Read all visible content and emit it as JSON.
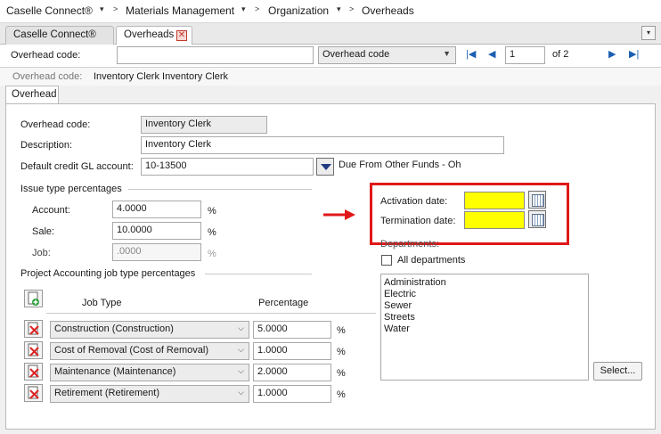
{
  "breadcrumb": {
    "items": [
      "Caselle Connect®",
      "Materials Management",
      "Organization",
      "Overheads"
    ]
  },
  "tabs": [
    {
      "label": "Caselle Connect®"
    },
    {
      "label": "Overheads"
    }
  ],
  "toolbar": {
    "code_label": "Overhead code:",
    "code_value": "",
    "sort_select": "Overhead code",
    "record_number": "1",
    "record_total": "of 2"
  },
  "subheader": {
    "label": "Overhead code:",
    "value": "Inventory Clerk  Inventory Clerk"
  },
  "inner_tab": "Overhead",
  "form": {
    "overhead_code_label": "Overhead code:",
    "overhead_code_value": "Inventory Clerk",
    "description_label": "Description:",
    "description_value": "Inventory Clerk",
    "gl_label": "Default credit GL account:",
    "gl_value": "10-13500",
    "gl_description": "Due From Other Funds - Oh"
  },
  "issue_type": {
    "title": "Issue type percentages",
    "account_label": "Account:",
    "account_value": "4.0000",
    "sale_label": "Sale:",
    "sale_value": "10.0000",
    "job_label": "Job:",
    "job_value": ".0000",
    "percent_sign": "%"
  },
  "dates": {
    "activation_label": "Activation date:",
    "activation_value": "",
    "termination_label": "Termination date:",
    "termination_value": ""
  },
  "departments": {
    "title": "Departments:",
    "all_label": "All departments",
    "items": [
      "Administration",
      "Electric",
      "Sewer",
      "Streets",
      "Water"
    ],
    "select_button": "Select..."
  },
  "pa": {
    "title": "Project Accounting job type percentages",
    "col_job": "Job Type",
    "col_pct": "Percentage",
    "rows": [
      {
        "job": "Construction (Construction)",
        "pct": "5.0000"
      },
      {
        "job": "Cost of Removal (Cost of Removal)",
        "pct": "1.0000"
      },
      {
        "job": "Maintenance (Maintenance)",
        "pct": "2.0000"
      },
      {
        "job": "Retirement (Retirement)",
        "pct": "1.0000"
      }
    ],
    "percent_sign": "%"
  },
  "annotation": {
    "highlight_color": "#e01818",
    "arrow_icon": "red-arrow-icon"
  }
}
